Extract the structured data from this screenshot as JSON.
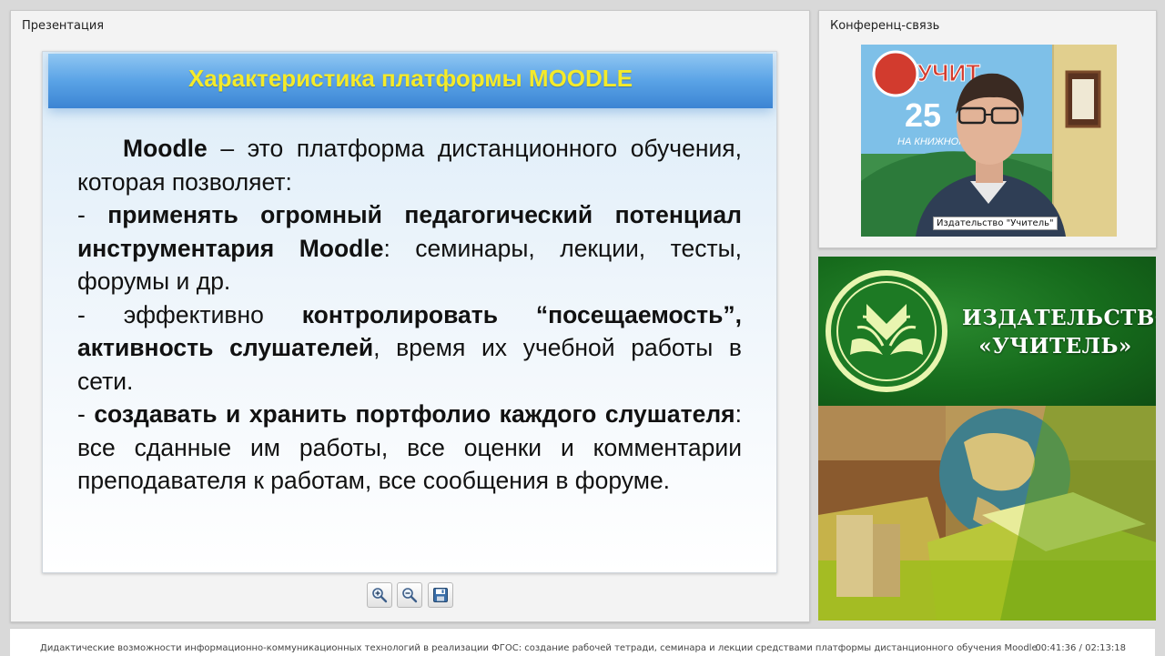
{
  "presentation_panel": {
    "title": "Презентация"
  },
  "conference_panel": {
    "title": "Конференц-связь",
    "video_caption": "Издательство \"Учитель\""
  },
  "slide": {
    "title": "Характеристика платформы MOODLE",
    "p1_bold": "Moodle",
    "p1_text": " – это платформа дистанционного обучения, которая позволяет:",
    "p2_prefix": "- ",
    "p2_bold": "применять огромный педагогический потенциал инструментария Moodle",
    "p2_text": ": семинары, лекции, тесты, форумы и др.",
    "p3_prefix": "- эффективно ",
    "p3_bold": "контролировать “посещаемость”, активность слушателей",
    "p3_text": ", время их учебной работы в сети.",
    "p4_prefix": "- ",
    "p4_bold": "создавать и хранить портфолио каждого слушателя",
    "p4_text": ": все сданные им работы, все оценки и комментарии преподавателя к работам, все сообщения в форуме."
  },
  "toolbar": {
    "icons": [
      "zoom-in-icon",
      "zoom-out-icon",
      "save-icon"
    ]
  },
  "publisher": {
    "name_line1": "ИЗДАТЕЛЬСТВО",
    "name_line2": "«УЧИТЕЛЬ»"
  },
  "status_bar": {
    "lecture_title": "Дидактические возможности информационно-коммуникационных технологий в реализации ФГОС: создание рабочей тетради, семинара и лекции средствами платформы дистанционного обучения Moodle",
    "timecode": "00:41:36 / 02:13:18"
  },
  "colors": {
    "slide_title": "#f4ea2a",
    "header_blue": "#5aa3e6",
    "publisher_green": "#166b1c"
  }
}
